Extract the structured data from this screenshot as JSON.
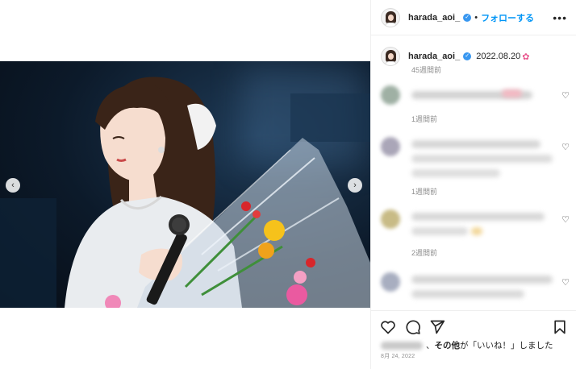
{
  "post": {
    "username": "harada_aoi_",
    "follow_label": "フォローする",
    "separator": "•",
    "more_icon": "more-horizontal-icon"
  },
  "caption": {
    "username": "harada_aoi_",
    "text": "2022.08.20",
    "emoji": "✿",
    "time": "45週間前"
  },
  "comments": [
    {
      "time": "1週間前"
    },
    {
      "time": "1週間前"
    },
    {
      "time": "2週間前"
    },
    {
      "time": ""
    }
  ],
  "footer": {
    "likes_text": "その他",
    "likes_suffix": "が「いいね！」しました",
    "likes_separator": "、",
    "date": "8月 24, 2022"
  },
  "photo": {
    "prev_label": "‹",
    "next_label": "›"
  },
  "colors": {
    "accent": "#0095f6",
    "verified": "#3897f0",
    "muted": "#8e8e8e"
  }
}
